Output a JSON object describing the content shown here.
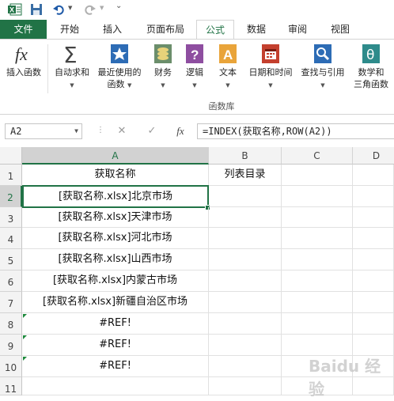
{
  "tabs": {
    "file": "文件",
    "items": [
      "开始",
      "插入",
      "页面布局",
      "公式",
      "数据",
      "审阅",
      "视图"
    ],
    "active": "公式"
  },
  "ribbon": {
    "buttons": [
      {
        "label": "插入函数",
        "icon": "fx-icon"
      },
      {
        "label": "自动求和",
        "icon": "sigma-icon"
      },
      {
        "label": "最近使用的\n函数",
        "icon": "star-book-icon"
      },
      {
        "label": "财务",
        "icon": "coins-book-icon"
      },
      {
        "label": "逻辑",
        "icon": "question-book-icon"
      },
      {
        "label": "文本",
        "icon": "text-book-icon"
      },
      {
        "label": "日期和时间",
        "icon": "calendar-book-icon"
      },
      {
        "label": "查找与引用",
        "icon": "magnifier-book-icon"
      },
      {
        "label": "数学和\n三角函数",
        "icon": "theta-book-icon"
      }
    ],
    "group_label": "函数库"
  },
  "formula_bar": {
    "name_box": "A2",
    "cancel": "✕",
    "enter": "✓",
    "fx": "fx",
    "formula": "=INDEX(获取名称,ROW(A2))"
  },
  "columns": [
    "A",
    "B",
    "C",
    "D"
  ],
  "rows": [
    "1",
    "2",
    "3",
    "4",
    "5",
    "6",
    "7",
    "8",
    "9",
    "10",
    "11"
  ],
  "cells": {
    "A1": "获取名称",
    "B1": "列表目录",
    "A2": "[获取名称.xlsx]北京市场",
    "A3": "[获取名称.xlsx]天津市场",
    "A4": "[获取名称.xlsx]河北市场",
    "A5": "[获取名称.xlsx]山西市场",
    "A6": "[获取名称.xlsx]内蒙古市场",
    "A7": "[获取名称.xlsx]新疆自治区市场",
    "A8": "#REF!",
    "A9": "#REF!",
    "A10": "#REF!"
  },
  "selected_cell": "A2",
  "colors": {
    "accent": "#217346"
  },
  "watermark": "Baidu 经验"
}
